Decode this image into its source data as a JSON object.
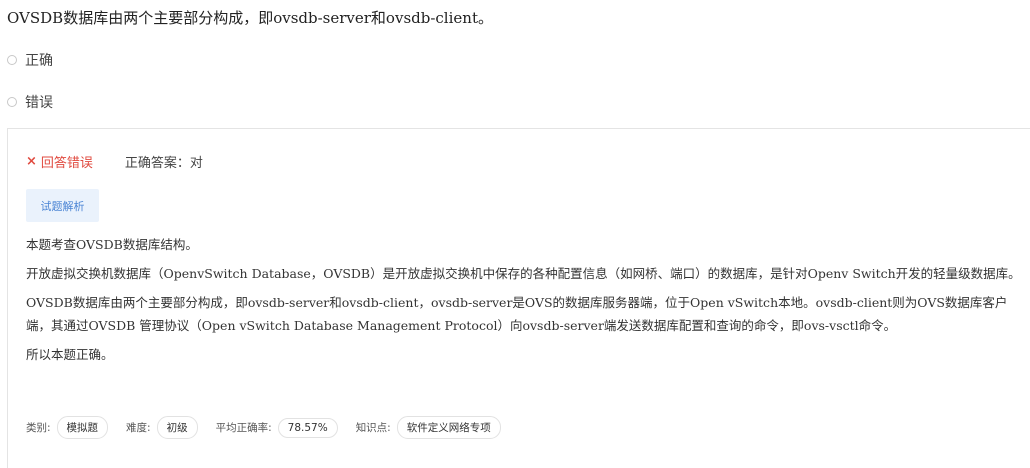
{
  "question": {
    "text": "OVSDB数据库由两个主要部分构成，即ovsdb-server和ovsdb-client。"
  },
  "options": [
    {
      "label": "正确"
    },
    {
      "label": "错误"
    }
  ],
  "result": {
    "status_text": "回答错误",
    "status_icon": "×",
    "correct_answer": "正确答案：对",
    "status_color": "#e04a3f"
  },
  "analysis_tab": {
    "label": "试题解析"
  },
  "analysis": {
    "paragraphs": [
      "本题考查OVSDB数据库结构。",
      "开放虚拟交换机数据库（OpenvSwitch Database，OVSDB）是开放虚拟交换机中保存的各种配置信息（如网桥、端口）的数据库，是针对Openv Switch开发的轻量级数据库。",
      "OVSDB数据库由两个主要部分构成，即ovsdb-server和ovsdb-client，ovsdb-server是OVS的数据库服务器端，位于Open vSwitch本地。ovsdb-client则为OVS数据库客户端，其通过OVSDB 管理协议（Open vSwitch Database Management Protocol）向ovsdb-server端发送数据库配置和查询的命令，即ovs-vsctl命令。",
      "所以本题正确。"
    ]
  },
  "meta": {
    "category_label": "类别:",
    "category_value": "模拟题",
    "difficulty_label": "难度:",
    "difficulty_value": "初级",
    "accuracy_label": "平均正确率:",
    "accuracy_value": "78.57%",
    "knowledge_label": "知识点:",
    "knowledge_value": "软件定义网络专项"
  },
  "colors": {
    "accent": "#4a84d4",
    "tab_bg": "#eaf2fc",
    "error": "#e04a3f"
  }
}
